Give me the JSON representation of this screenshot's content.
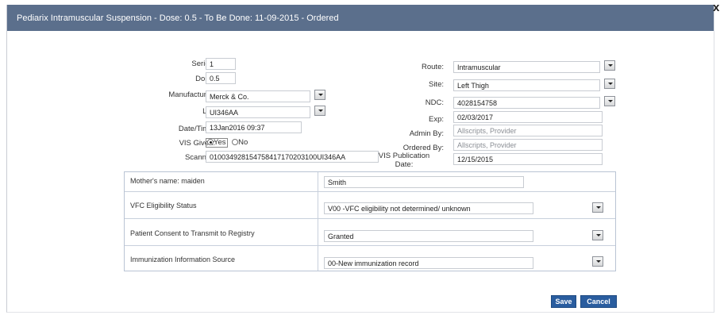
{
  "dialog": {
    "title": "Pediarix Intramuscular Suspension - Dose: 0.5 - To Be Done: 11-09-2015 - Ordered",
    "close_glyph": "x"
  },
  "form": {
    "series_label": "Series:",
    "series_value": "1",
    "dose_label": "Dose:",
    "dose_value": "0.5",
    "manufacturer_label": "Manufacturer:",
    "manufacturer_value": "Merck & Co.",
    "lot_label": "Lot:",
    "lot_value": "UI346AA",
    "datetime_label": "Date/Time:",
    "datetime_value": "13Jan2016 09:37",
    "vis_given_label": "VIS Given:",
    "vis_yes": "Yes",
    "vis_no": "No",
    "scanner_label": "Scanner:",
    "scanner_value": "010034928154758417170203100UI346AA",
    "route_label": "Route:",
    "route_value": "Intramuscular",
    "site_label": "Site:",
    "site_value": "Left Thigh",
    "ndc_label": "NDC:",
    "ndc_value": "4028154758",
    "exp_label": "Exp:",
    "exp_value": "02/03/2017",
    "admin_by_label": "Admin By:",
    "admin_by_value": "Allscripts, Provider",
    "ordered_by_label": "Ordered By:",
    "ordered_by_value": "Allscripts, Provider",
    "vis_pub_label_line1": "VIS Publication",
    "vis_pub_label_line2": "Date:",
    "vis_pub_value": "12/15/2015"
  },
  "registry": {
    "mothers_name_label": "Mother's name: maiden",
    "mothers_name_value": "Smith",
    "vfc_label": "VFC Eligibility Status",
    "vfc_value": "V00 -VFC eligibility not determined/ unknown",
    "consent_label": "Patient Consent to Transmit to Registry",
    "consent_value": "Granted",
    "source_label": "Immunization Information Source",
    "source_value": "00-New immunization record"
  },
  "actions": {
    "save_label": "Save",
    "cancel_label": "Cancel"
  },
  "colors": {
    "titlebar": "#5b6f8c",
    "button": "#2a5d9f"
  }
}
